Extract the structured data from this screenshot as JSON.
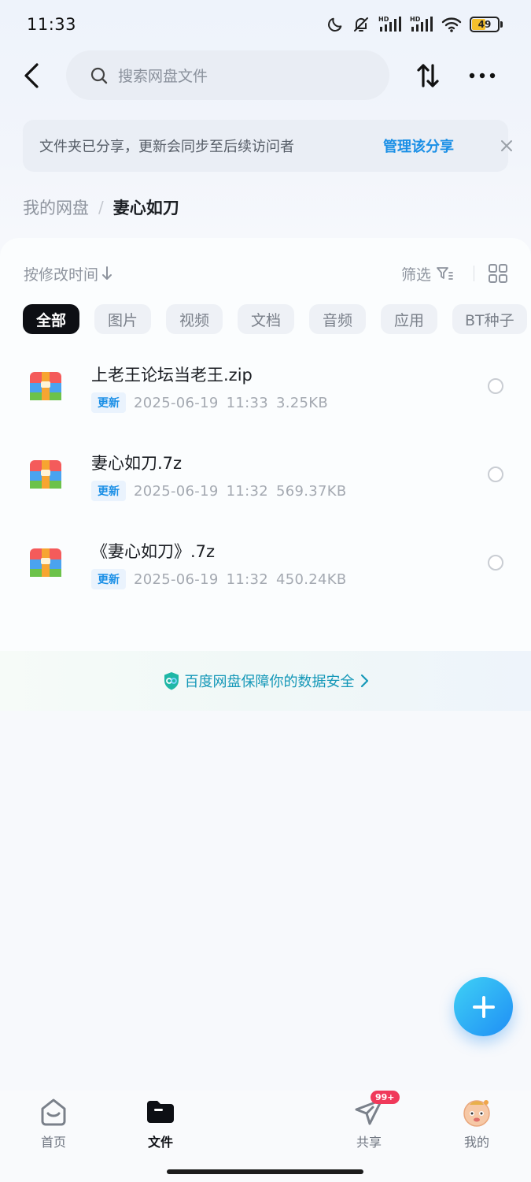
{
  "status_bar": {
    "time": "11:33",
    "battery": "49",
    "battery_level_percent": 49,
    "battery_color": "#f5c02c",
    "icons": [
      "moon-icon",
      "bell-muted-icon",
      "signal-hd-icon",
      "signal-hd-icon",
      "wifi-icon",
      "battery-icon"
    ],
    "hd_label": "HD"
  },
  "header": {
    "search_placeholder": "搜索网盘文件",
    "back_icon": "chevron-left-icon",
    "sort_icon": "swap-vertical-icon",
    "more_icon": "more-horizontal-icon"
  },
  "notice": {
    "text": "文件夹已分享，更新会同步至后续访问者",
    "link": "管理该分享",
    "close_icon": "close-icon"
  },
  "breadcrumb": {
    "root": "我的网盘",
    "separator": "/",
    "current": "妻心如刀"
  },
  "toolbar": {
    "sort_label": "按修改时间",
    "sort_icon": "arrow-down-icon",
    "filter_label": "筛选",
    "filter_icon": "filter-icon",
    "view_icon": "grid-view-icon"
  },
  "filter_chips": [
    {
      "label": "全部",
      "active": true
    },
    {
      "label": "图片",
      "active": false
    },
    {
      "label": "视频",
      "active": false
    },
    {
      "label": "文档",
      "active": false
    },
    {
      "label": "音频",
      "active": false
    },
    {
      "label": "应用",
      "active": false
    },
    {
      "label": "BT种子",
      "active": false
    }
  ],
  "files": [
    {
      "name": "上老王论坛当老王.zip",
      "badge": "更新",
      "date": "2025-06-19",
      "time": "11:33",
      "size": "3.25KB",
      "icon": "archive-icon"
    },
    {
      "name": "妻心如刀.7z",
      "badge": "更新",
      "date": "2025-06-19",
      "time": "11:32",
      "size": "569.37KB",
      "icon": "archive-icon"
    },
    {
      "name": "《妻心如刀》.7z",
      "badge": "更新",
      "date": "2025-06-19",
      "time": "11:32",
      "size": "450.24KB",
      "icon": "archive-icon"
    }
  ],
  "safety_banner": {
    "text": "百度网盘保障你的数据安全",
    "icon": "shield-icon",
    "chevron_icon": "chevron-right-icon"
  },
  "fab": {
    "icon": "plus-icon"
  },
  "bottom_nav": [
    {
      "label": "首页",
      "icon": "home-icon",
      "active": false
    },
    {
      "label": "文件",
      "icon": "folder-icon",
      "active": true
    },
    {
      "label": "共享",
      "icon": "send-icon",
      "active": false,
      "badge": "99+"
    },
    {
      "label": "我的",
      "icon": "avatar-icon",
      "active": false
    }
  ],
  "colors": {
    "accent": "#1a8fe6",
    "active_chip": "#0d0f14",
    "badge_red": "#f0395a",
    "safety_text": "#1598b8"
  }
}
